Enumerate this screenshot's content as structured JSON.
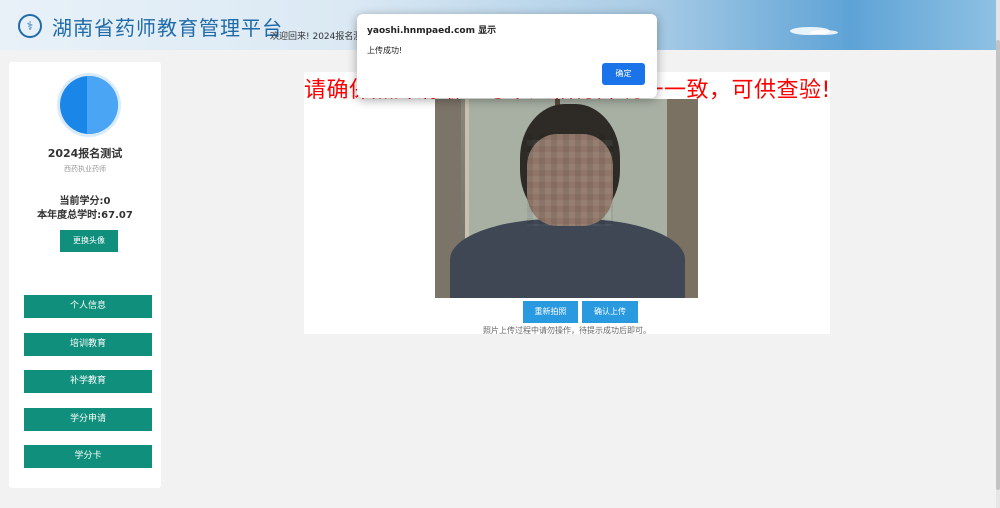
{
  "header": {
    "logo_glyph": "⚕",
    "title": "湖南省药师教育管理平台",
    "welcome": "欢迎回来! 2024报名测"
  },
  "sidebar": {
    "user_name": "2024报名测试",
    "user_role": "西药执业药师",
    "credits": "当前学分:0",
    "total_hours": "本年度总学时:67.07",
    "change_avatar_label": "更换头像",
    "nav": [
      {
        "label": "个人信息"
      },
      {
        "label": "培训教育"
      },
      {
        "label": "补学教育"
      },
      {
        "label": "学分申请"
      },
      {
        "label": "学分卡"
      }
    ]
  },
  "main": {
    "confirm_message": "请确保照片清晰且与本人相符并统一一致，可供查验!",
    "retake_label": "重新拍照",
    "upload_label": "确认上传",
    "hint": "照片上传过程中请勿操作，待提示成功后即可。"
  },
  "dialog": {
    "title": "yaoshi.hnmpaed.com 显示",
    "message": "上传成功!",
    "ok_label": "确定"
  },
  "colors": {
    "brand_green": "#0f8f7c",
    "accent_blue": "#2a9ae0",
    "warning_red": "#ff0000",
    "dialog_button": "#1a73e8"
  }
}
